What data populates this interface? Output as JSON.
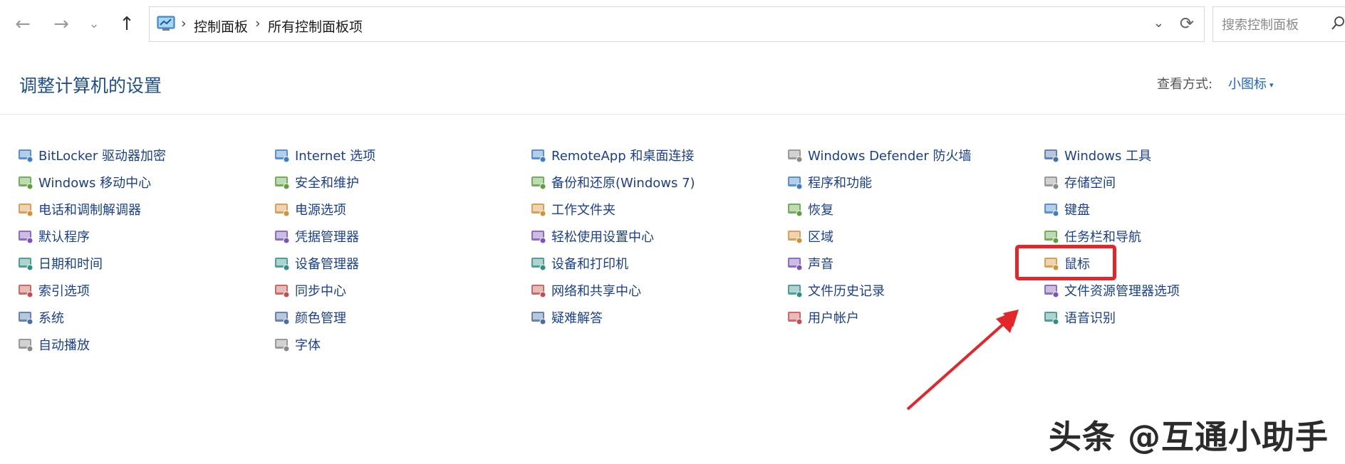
{
  "nav": {
    "breadcrumb": [
      "控制面板",
      "所有控制面板项"
    ],
    "search_placeholder": "搜索控制面板"
  },
  "header": {
    "title": "调整计算机的设置",
    "view_by_label": "查看方式:",
    "view_by_value": "小图标"
  },
  "items": [
    {
      "label": "BitLocker 驱动器加密",
      "icon": "bitlocker-icon"
    },
    {
      "label": "Windows 移动中心",
      "icon": "mobility-center-icon"
    },
    {
      "label": "电话和调制解调器",
      "icon": "phone-modem-icon"
    },
    {
      "label": "默认程序",
      "icon": "default-programs-icon"
    },
    {
      "label": "日期和时间",
      "icon": "date-time-icon"
    },
    {
      "label": "索引选项",
      "icon": "indexing-icon"
    },
    {
      "label": "系统",
      "icon": "system-icon"
    },
    {
      "label": "自动播放",
      "icon": "autoplay-icon"
    },
    {
      "label": "Internet 选项",
      "icon": "internet-options-icon"
    },
    {
      "label": "安全和维护",
      "icon": "security-flag-icon"
    },
    {
      "label": "电源选项",
      "icon": "power-icon"
    },
    {
      "label": "凭据管理器",
      "icon": "credential-icon"
    },
    {
      "label": "设备管理器",
      "icon": "device-manager-icon"
    },
    {
      "label": "同步中心",
      "icon": "sync-icon"
    },
    {
      "label": "颜色管理",
      "icon": "color-management-icon"
    },
    {
      "label": "字体",
      "icon": "fonts-icon"
    },
    {
      "label": "RemoteApp 和桌面连接",
      "icon": "remoteapp-icon"
    },
    {
      "label": "备份和还原(Windows 7)",
      "icon": "backup-icon"
    },
    {
      "label": "工作文件夹",
      "icon": "work-folders-icon"
    },
    {
      "label": "轻松使用设置中心",
      "icon": "ease-of-access-icon"
    },
    {
      "label": "设备和打印机",
      "icon": "printer-icon"
    },
    {
      "label": "网络和共享中心",
      "icon": "network-icon"
    },
    {
      "label": "疑难解答",
      "icon": "troubleshoot-icon"
    },
    {
      "label": "Windows Defender 防火墙",
      "icon": "firewall-icon"
    },
    {
      "label": "程序和功能",
      "icon": "programs-icon"
    },
    {
      "label": "恢复",
      "icon": "recovery-icon"
    },
    {
      "label": "区域",
      "icon": "region-icon"
    },
    {
      "label": "声音",
      "icon": "sound-icon"
    },
    {
      "label": "文件历史记录",
      "icon": "file-history-icon"
    },
    {
      "label": "用户帐户",
      "icon": "user-accounts-icon"
    },
    {
      "label": "Windows 工具",
      "icon": "windows-tools-icon"
    },
    {
      "label": "存储空间",
      "icon": "storage-icon"
    },
    {
      "label": "键盘",
      "icon": "keyboard-icon"
    },
    {
      "label": "任务栏和导航",
      "icon": "taskbar-icon"
    },
    {
      "label": "鼠标",
      "icon": "mouse-icon"
    },
    {
      "label": "文件资源管理器选项",
      "icon": "explorer-options-icon"
    },
    {
      "label": "语音识别",
      "icon": "speech-icon"
    }
  ],
  "watermark": "头条 @互通小助手",
  "colors": {
    "link": "#1a3f8f",
    "heading": "#1d4e89",
    "highlight": "#e3262a"
  }
}
